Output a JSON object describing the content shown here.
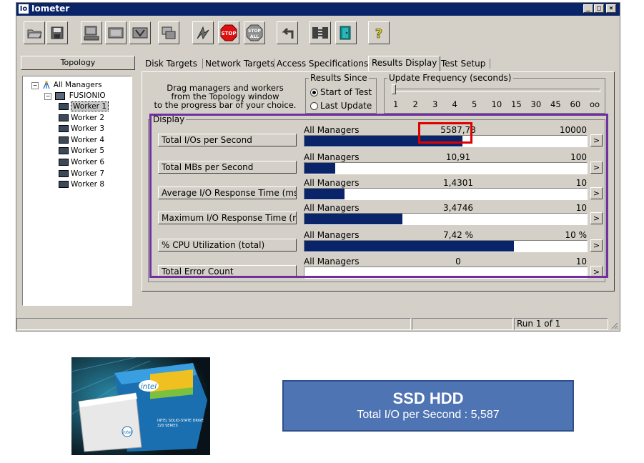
{
  "window": {
    "title": "Iometer",
    "logo": "Io",
    "caption_buttons": [
      "_",
      "□",
      "×"
    ]
  },
  "toolbar": {
    "icons": [
      "open-icon",
      "save-icon",
      "new-manager-icon",
      "new-worker-icon",
      "disk-worker-icon",
      "copy-worker-icon",
      "start-icon",
      "stop-icon",
      "stop-all-icon",
      "reset-icon",
      "disconnect-icon",
      "exit-icon",
      "help-icon"
    ],
    "stop_label": "STOP",
    "stop_all_label": "STOP ALL",
    "help_label": "?"
  },
  "topology": {
    "header": "Topology",
    "root": "All Managers",
    "manager": "FUSIONIO",
    "workers": [
      "Worker 1",
      "Worker 2",
      "Worker 3",
      "Worker 4",
      "Worker 5",
      "Worker 6",
      "Worker 7",
      "Worker 8"
    ],
    "selected_worker": "Worker 1"
  },
  "tabs": [
    {
      "label": "Disk Targets",
      "active": false
    },
    {
      "label": "Network Targets",
      "active": false
    },
    {
      "label": "Access Specifications",
      "active": false
    },
    {
      "label": "Results Display",
      "active": true
    },
    {
      "label": "Test Setup",
      "active": false
    }
  ],
  "results_display": {
    "hint": "Drag managers and workers from the Topology window to the progress bar of your choice.",
    "hint_lines": [
      "Drag managers and workers",
      "from the Topology window",
      "to the progress bar of your choice."
    ],
    "results_since": {
      "title": "Results Since",
      "options": [
        "Start of Test",
        "Last Update"
      ],
      "selected": "Start of Test"
    },
    "update_frequency": {
      "title": "Update Frequency (seconds)",
      "ticks": [
        "1",
        "2",
        "3",
        "4",
        "5",
        "10",
        "15",
        "30",
        "45",
        "60",
        "oo"
      ],
      "selected": "1"
    },
    "display_title": "Display",
    "metrics": [
      {
        "label": "Total I/Os per Second",
        "source": "All Managers",
        "value": "5587,78",
        "max": "10000",
        "fill": 0.5588
      },
      {
        "label": "Total MBs per Second",
        "source": "All Managers",
        "value": "10,91",
        "max": "100",
        "fill": 0.1091
      },
      {
        "label": "Average I/O Response Time (ms)",
        "source": "All Managers",
        "value": "1,4301",
        "max": "10",
        "fill": 0.143
      },
      {
        "label": "Maximum I/O Response Time (ms)",
        "source": "All Managers",
        "value": "3,4746",
        "max": "10",
        "fill": 0.3475
      },
      {
        "label": "% CPU Utilization (total)",
        "source": "All Managers",
        "value": "7,42 %",
        "max": "10 %",
        "fill": 0.742
      },
      {
        "label": "Total Error Count",
        "source": "All Managers",
        "value": "0",
        "max": "10",
        "fill": 0
      }
    ],
    "arrow_label": ">"
  },
  "status_bar": {
    "run": "Run 1 of 1"
  },
  "highlight_colors": {
    "value_highlight": "#e00000",
    "display_highlight": "#7030a0",
    "bar": "#0a246a"
  },
  "caption": {
    "title": "SSD HDD",
    "subtitle": "Total I/O per Second : 5,587"
  },
  "photo": {
    "brand": "intel",
    "product_line_1": "INTEL SOLID-STATE DRIVE",
    "product_line_2": "320 SERIES"
  }
}
